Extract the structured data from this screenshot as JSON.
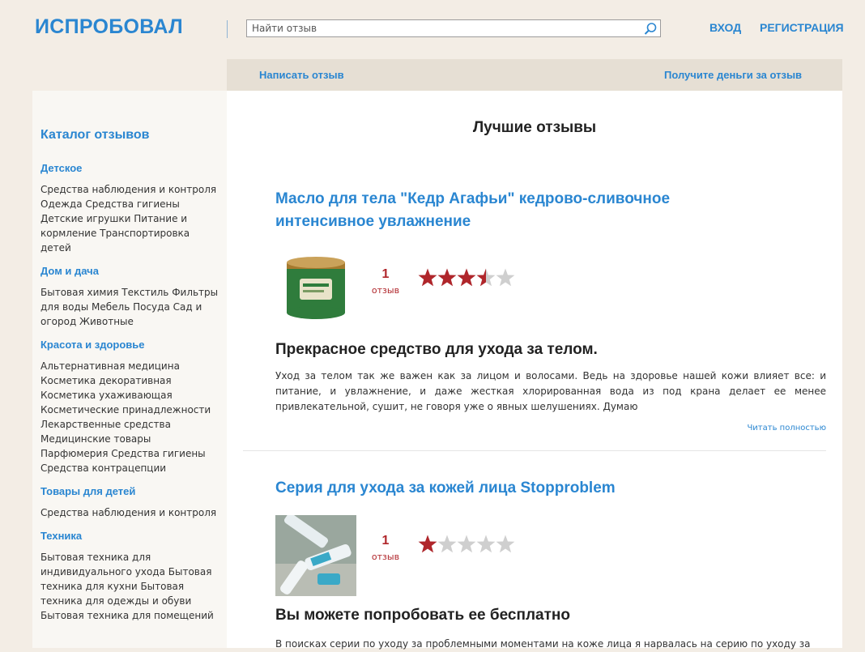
{
  "header": {
    "logo": "ИСПРОБОВАЛ",
    "search_placeholder": "Найти отзыв",
    "login": "ВХОД",
    "register": "РЕГИСТРАЦИЯ"
  },
  "nav": {
    "write_review": "Написать отзыв",
    "get_money": "Получите деньги за отзыв"
  },
  "sidebar": {
    "title": "Каталог отзывов",
    "categories": [
      {
        "name": "Детское",
        "items": "Средства наблюдения и контроля Одежда Средства гигиены Детские игрушки Питание и кормление Транспортировка детей"
      },
      {
        "name": "Дом и дача",
        "items": "Бытовая химия Текстиль Фильтры для воды Мебель Посуда Сад и огород Животные"
      },
      {
        "name": "Красота и здоровье",
        "items": "Альтернативная медицина Косметика декоративная Косметика ухаживающая Косметические принадлежности Лекарственные средства Медицинские товары Парфюмерия Средства гигиены Средства контрацепции"
      },
      {
        "name": "Товары для детей",
        "items": "Средства наблюдения и контроля"
      },
      {
        "name": "Техника",
        "items": "Бытовая техника для индивидуального ухода Бытовая техника для кухни Бытовая техника для одежды и обуви Бытовая техника для помещений"
      }
    ]
  },
  "main": {
    "title": "Лучшие отзывы",
    "reviews": [
      {
        "product": "Масло для тела \"Кедр Агафьи\" кедрово-сливочное интенсивное увлажнение",
        "count": "1",
        "count_label": "отзыв",
        "rating": 3.5,
        "headline": "Прекрасное средство для ухода за телом.",
        "text": "Уход за телом так же важен как за лицом и волосами. Ведь на здоровье нашей кожи влияет все: и питание, и увлажнение, и даже жесткая хлорированная вода из под крана делает ее менее привлекательной, сушит, не говоря уже о явных шелушениях. Думаю",
        "read_more": "Читать полностью"
      },
      {
        "product": "Серия для ухода за кожей лица Stopproblem",
        "count": "1",
        "count_label": "отзыв",
        "rating": 1,
        "headline": "Вы можете попробовать ее бесплатно",
        "text": "В поисках серии по уходу за проблемными моментами на коже лица я нарвалась на серию по уходу за"
      }
    ]
  },
  "colors": {
    "accent": "#2a86d1",
    "star_on": "#b0262b",
    "star_off": "#cfcfcf",
    "background": "#f3ede5"
  }
}
